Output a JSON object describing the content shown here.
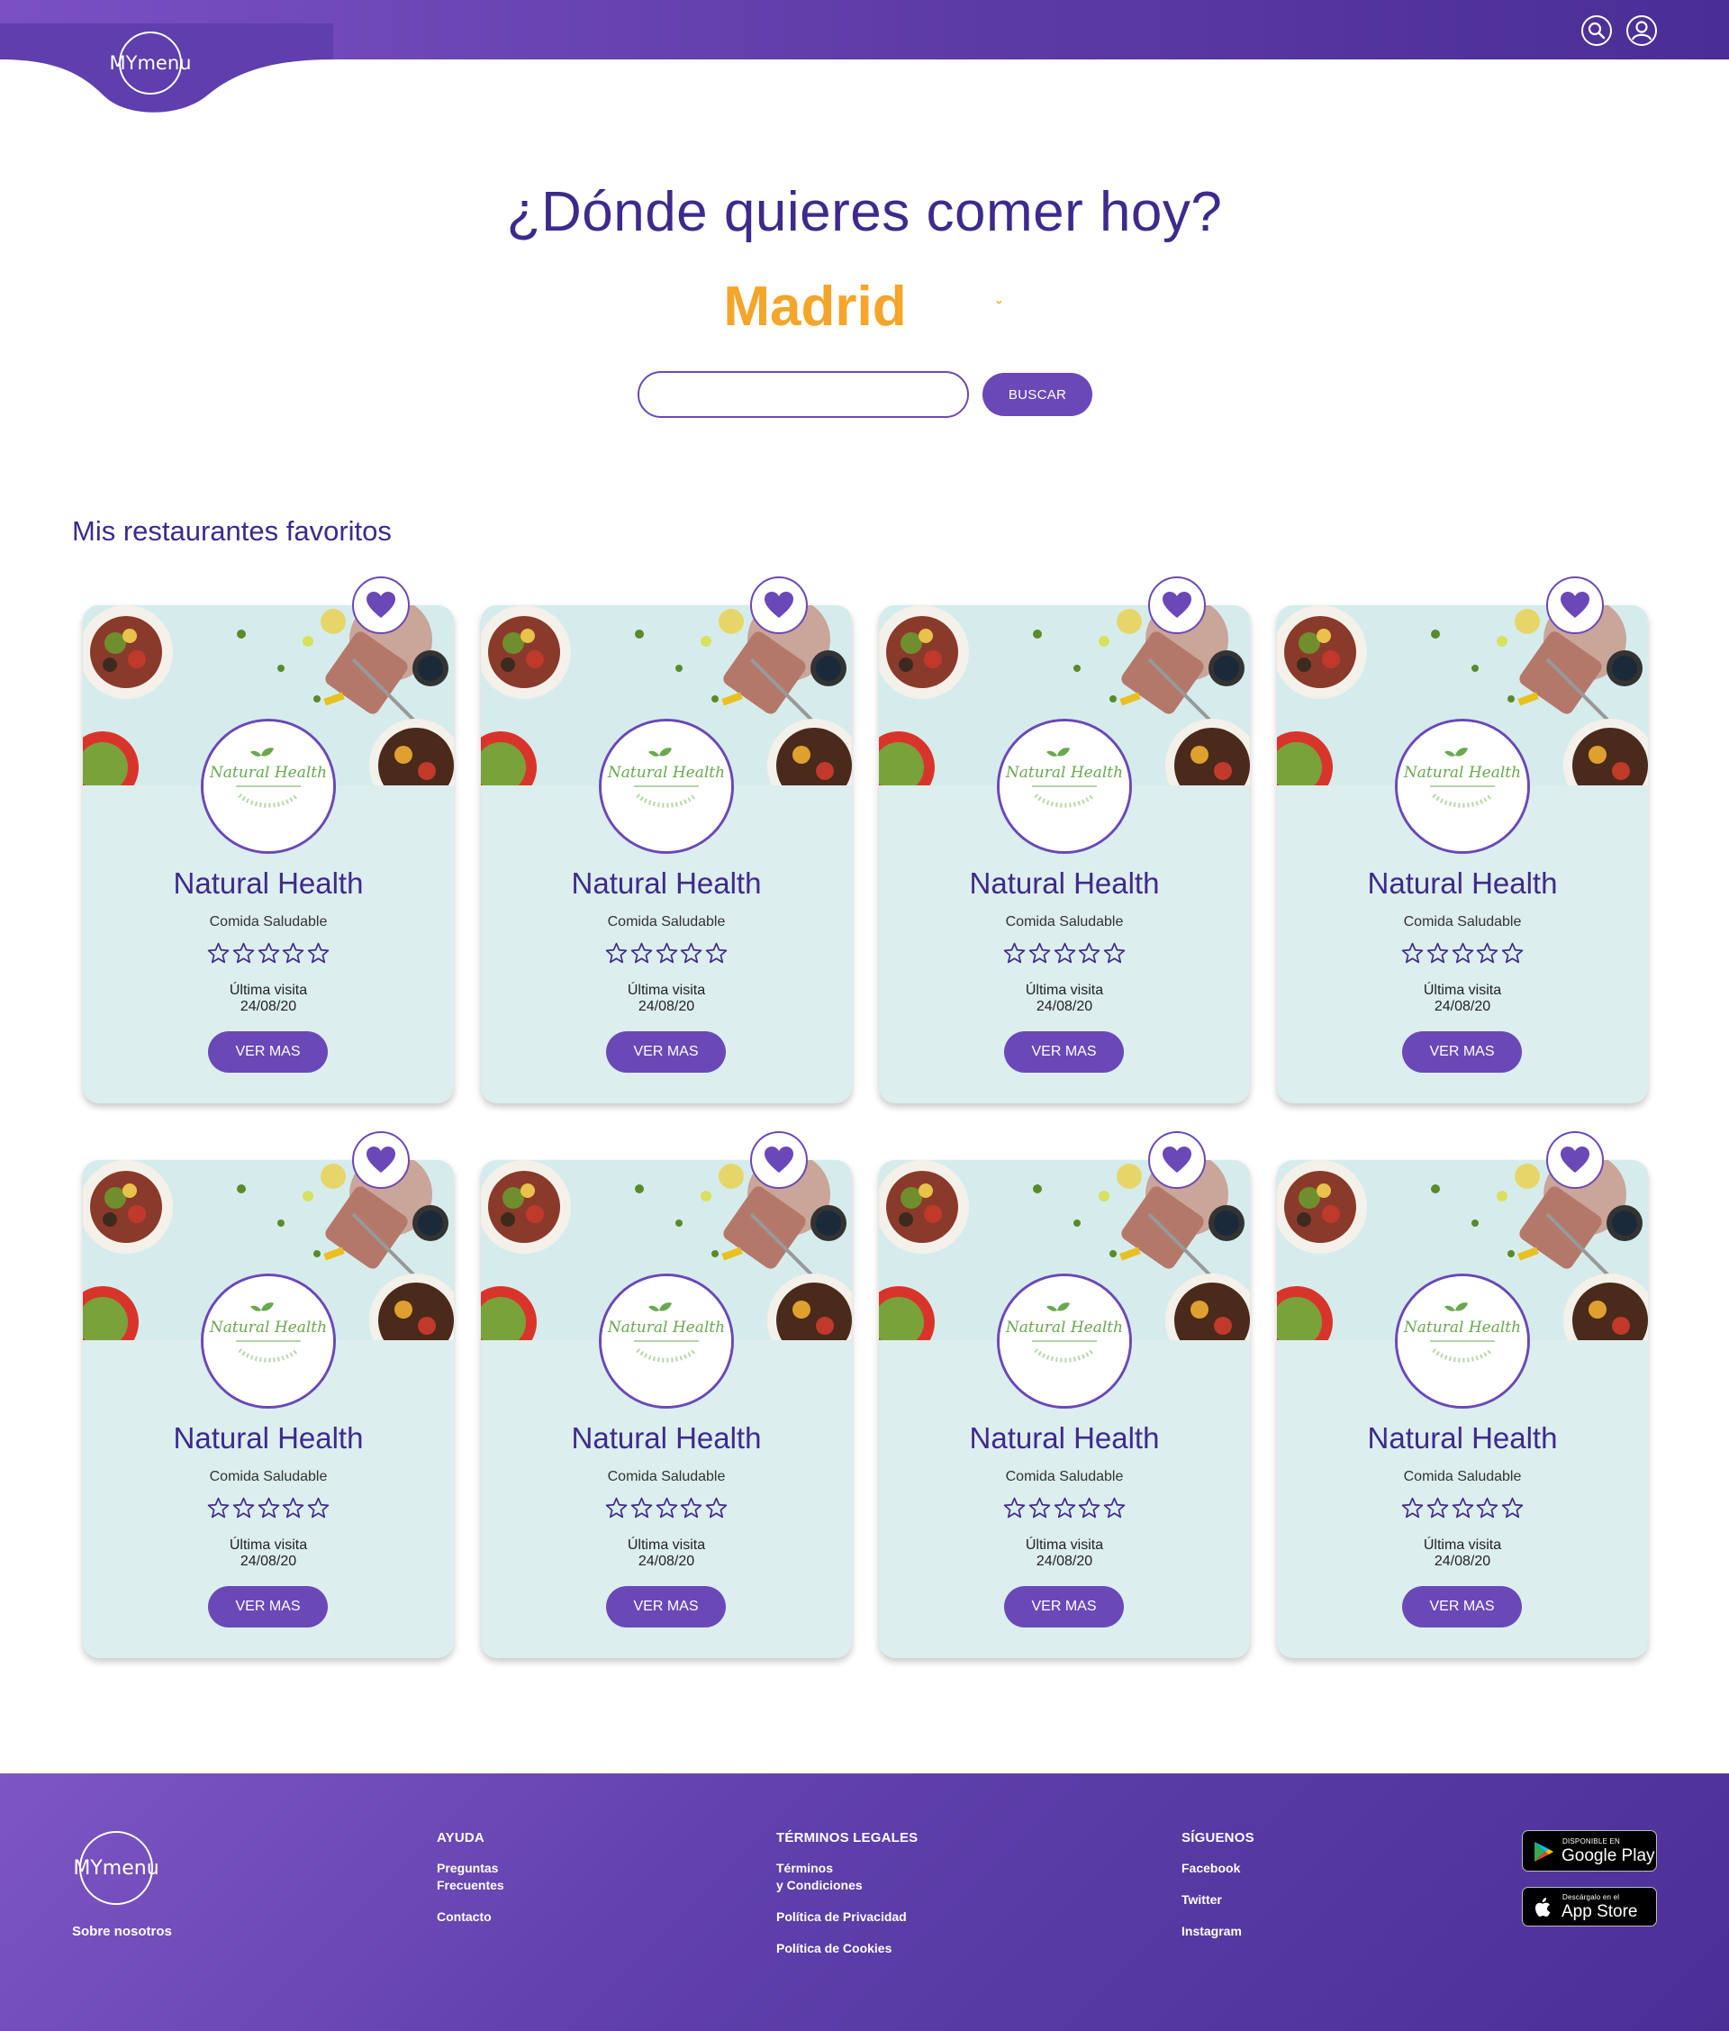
{
  "header": {
    "logo_text": "MYmenu",
    "search_icon": "search-icon",
    "user_icon": "user-icon"
  },
  "hero": {
    "title": "¿Dónde quieres comer hoy?",
    "city": "Madrid",
    "caret": "ˇ",
    "search_placeholder": "",
    "search_button": "BUSCAR"
  },
  "favorites": {
    "title": "Mis restaurantes favoritos",
    "cards": [
      {
        "name": "Natural Health",
        "category": "Comida Saludable",
        "rating": 0,
        "visit_label": "Última visita",
        "visit_date": "24/08/20",
        "button": "VER MAS",
        "logo_text": "Natural Health"
      },
      {
        "name": "Natural Health",
        "category": "Comida Saludable",
        "rating": 0,
        "visit_label": "Última visita",
        "visit_date": "24/08/20",
        "button": "VER MAS",
        "logo_text": "Natural Health"
      },
      {
        "name": "Natural Health",
        "category": "Comida Saludable",
        "rating": 0,
        "visit_label": "Última visita",
        "visit_date": "24/08/20",
        "button": "VER MAS",
        "logo_text": "Natural Health"
      },
      {
        "name": "Natural Health",
        "category": "Comida Saludable",
        "rating": 0,
        "visit_label": "Última visita",
        "visit_date": "24/08/20",
        "button": "VER MAS",
        "logo_text": "Natural Health"
      },
      {
        "name": "Natural Health",
        "category": "Comida Saludable",
        "rating": 0,
        "visit_label": "Última visita",
        "visit_date": "24/08/20",
        "button": "VER MAS",
        "logo_text": "Natural Health"
      },
      {
        "name": "Natural Health",
        "category": "Comida Saludable",
        "rating": 0,
        "visit_label": "Última visita",
        "visit_date": "24/08/20",
        "button": "VER MAS",
        "logo_text": "Natural Health"
      },
      {
        "name": "Natural Health",
        "category": "Comida Saludable",
        "rating": 0,
        "visit_label": "Última visita",
        "visit_date": "24/08/20",
        "button": "VER MAS",
        "logo_text": "Natural Health"
      },
      {
        "name": "Natural Health",
        "category": "Comida Saludable",
        "rating": 0,
        "visit_label": "Última visita",
        "visit_date": "24/08/20",
        "button": "VER MAS",
        "logo_text": "Natural Health"
      }
    ]
  },
  "footer": {
    "logo_text": "MYmenu",
    "about": "Sobre nosotros",
    "help": {
      "heading": "AYUDA",
      "links": [
        "Preguntas\nFrecuentes",
        "Contacto"
      ]
    },
    "legal": {
      "heading": "TÉRMINOS LEGALES",
      "links": [
        "Términos\ny Condiciones",
        "Política de Privacidad",
        "Política de Cookies"
      ]
    },
    "social": {
      "heading": "SÍGUENOS",
      "links": [
        "Facebook",
        "Twitter",
        "Instagram"
      ]
    },
    "google_play": {
      "small": "DISPONIBLE EN",
      "big": "Google Play"
    },
    "app_store": {
      "small": "Descárgalo en el",
      "big": "App Store"
    }
  },
  "colors": {
    "brand_purple": "#6b48b8",
    "title_purple": "#3e2a8c",
    "accent_orange": "#f4a52a",
    "card_bg": "#dceeed"
  }
}
